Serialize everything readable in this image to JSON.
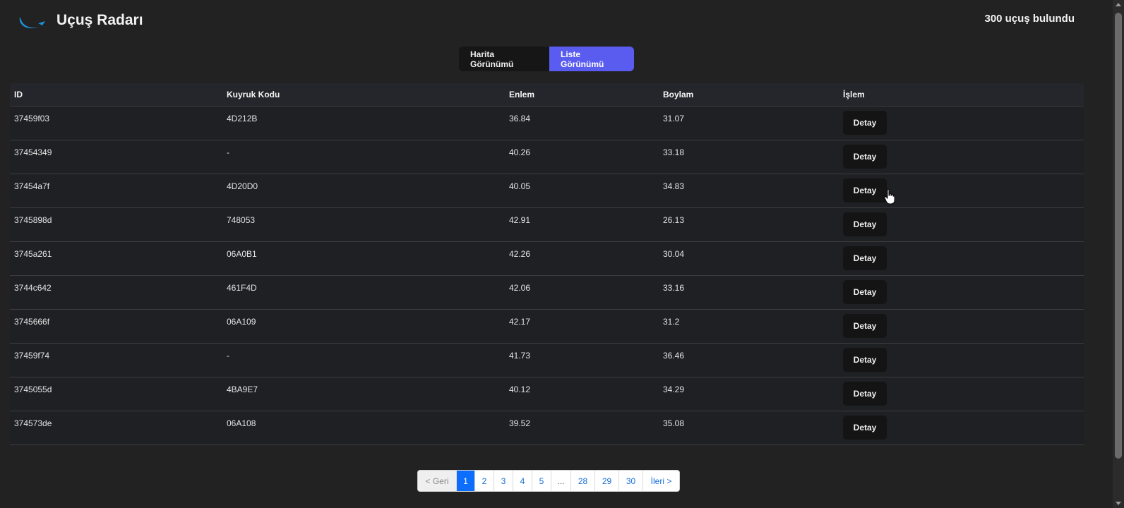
{
  "header": {
    "logo_icon": "plane-swoosh-icon",
    "title": "Uçuş Radarı",
    "flight_count": "300 uçuş bulundu"
  },
  "view_toggle": {
    "map_label": "Harita Görünümü",
    "list_label": "Liste Görünümü",
    "active": "list",
    "active_color": "#5a5cf0"
  },
  "table": {
    "columns": [
      "ID",
      "Kuyruk Kodu",
      "Enlem",
      "Boylam",
      "İşlem"
    ],
    "rows": [
      {
        "id": "37459f03",
        "tail": "4D212B",
        "lat": "36.84",
        "lon": "31.07",
        "action": "Detay"
      },
      {
        "id": "37454349",
        "tail": "-",
        "lat": "40.26",
        "lon": "33.18",
        "action": "Detay"
      },
      {
        "id": "37454a7f",
        "tail": "4D20D0",
        "lat": "40.05",
        "lon": "34.83",
        "action": "Detay"
      },
      {
        "id": "3745898d",
        "tail": "748053",
        "lat": "42.91",
        "lon": "26.13",
        "action": "Detay"
      },
      {
        "id": "3745a261",
        "tail": "06A0B1",
        "lat": "42.26",
        "lon": "30.04",
        "action": "Detay"
      },
      {
        "id": "3744c642",
        "tail": "461F4D",
        "lat": "42.06",
        "lon": "33.16",
        "action": "Detay"
      },
      {
        "id": "3745666f",
        "tail": "06A109",
        "lat": "42.17",
        "lon": "31.2",
        "action": "Detay"
      },
      {
        "id": "37459f74",
        "tail": "-",
        "lat": "41.73",
        "lon": "36.46",
        "action": "Detay"
      },
      {
        "id": "3745055d",
        "tail": "4BA9E7",
        "lat": "40.12",
        "lon": "34.29",
        "action": "Detay"
      },
      {
        "id": "374573de",
        "tail": "06A108",
        "lat": "39.52",
        "lon": "35.08",
        "action": "Detay"
      }
    ]
  },
  "pagination": {
    "prev": "< Geri",
    "pages": [
      "1",
      "2",
      "3",
      "4",
      "5",
      "...",
      "28",
      "29",
      "30"
    ],
    "current": "1",
    "next": "İleri >",
    "active_color": "#0d6efd"
  }
}
